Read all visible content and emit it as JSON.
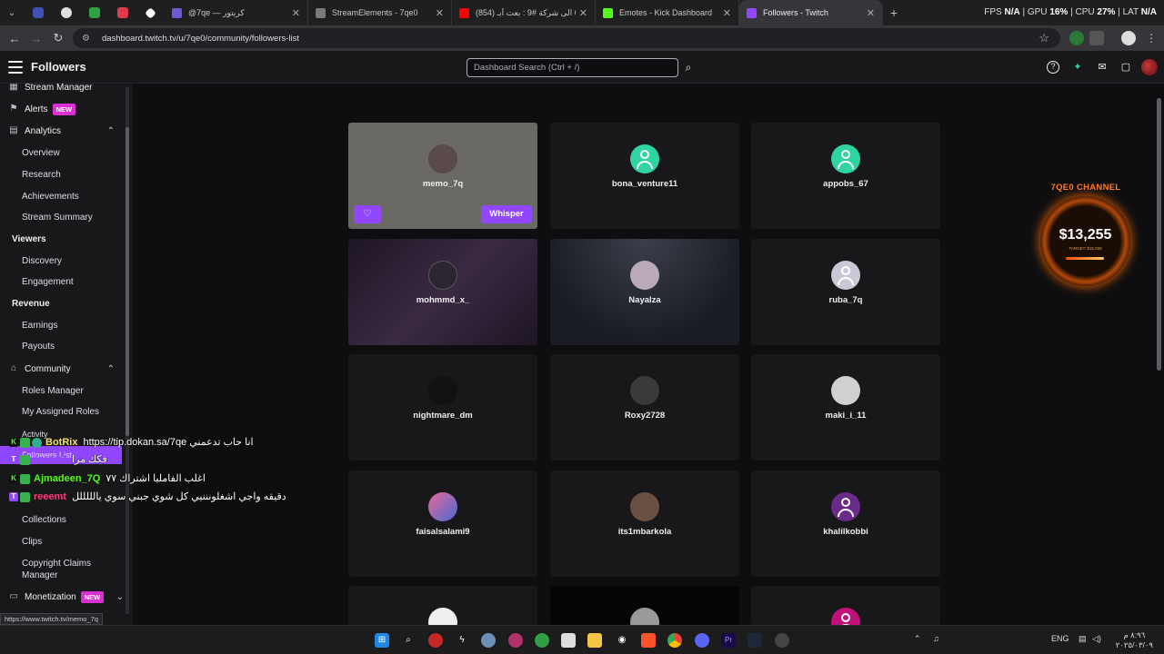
{
  "browser": {
    "tabs": [
      {
        "title": "@7qe — كريتور",
        "color": "#6b5bd6"
      },
      {
        "title": "StreamElements - 7qe0",
        "color": "#7a7a7a"
      },
      {
        "title": "(854) من 0 الى شركة #9 : بعت أبـ...",
        "color": "#ff0000"
      },
      {
        "title": "Emotes - Kick Dashboard",
        "color": "#53fc18"
      },
      {
        "title": "Followers - Twitch",
        "color": "#9147ff"
      }
    ],
    "stats": {
      "fps_label": "FPS",
      "fps_value": "N/A",
      "gpu_label": "GPU",
      "gpu_value": "16%",
      "cpu_label": "CPU",
      "cpu_value": "27%",
      "lat_label": "LAT",
      "lat_value": "N/A"
    },
    "url": "dashboard.twitch.tv/u/7qe0/community/followers-list"
  },
  "header": {
    "title": "Followers",
    "search_placeholder": "Dashboard Search (Ctrl + /)"
  },
  "sidebar": {
    "items": [
      {
        "label": "Stream Manager",
        "kind": "top"
      },
      {
        "label": "Alerts",
        "kind": "top",
        "badge": "NEW"
      },
      {
        "label": "Analytics",
        "kind": "top"
      },
      {
        "label": "Overview",
        "kind": "sub"
      },
      {
        "label": "Research",
        "kind": "sub"
      },
      {
        "label": "Achievements",
        "kind": "sub"
      },
      {
        "label": "Stream Summary",
        "kind": "sub"
      },
      {
        "label": "Viewers",
        "kind": "head"
      },
      {
        "label": "Discovery",
        "kind": "sub"
      },
      {
        "label": "Engagement",
        "kind": "sub"
      },
      {
        "label": "Revenue",
        "kind": "head"
      },
      {
        "label": "Earnings",
        "kind": "sub"
      },
      {
        "label": "Payouts",
        "kind": "sub"
      },
      {
        "label": "Community",
        "kind": "top"
      },
      {
        "label": "Roles Manager",
        "kind": "sub"
      },
      {
        "label": "My Assigned Roles",
        "kind": "sub"
      },
      {
        "label": "Activity",
        "kind": "sub"
      },
      {
        "label": "Followers List",
        "kind": "sub"
      },
      {
        "label": "Collections",
        "kind": "sub"
      },
      {
        "label": "Clips",
        "kind": "sub"
      },
      {
        "label": "Copyright Claims",
        "kind": "sub"
      },
      {
        "label": "Manager",
        "kind": "sub"
      },
      {
        "label": "Monetization",
        "kind": "top",
        "badge": "NEW"
      }
    ]
  },
  "followers": [
    {
      "name": "memo_7q",
      "avatar": "#5a4a4a"
    },
    {
      "name": "bona_venture11",
      "avatar": "default"
    },
    {
      "name": "appobs_67",
      "avatar": "default"
    },
    {
      "name": "mohmmd_x_",
      "avatar": "#2a2530"
    },
    {
      "name": "Nayalza",
      "avatar": "#b9a9b9"
    },
    {
      "name": "ruba_7q",
      "avatar": "#c9c8d6"
    },
    {
      "name": "nightmare_dm",
      "avatar": "#111111"
    },
    {
      "name": "Roxy2728",
      "avatar": "#3a3a3a"
    },
    {
      "name": "maki_i_11",
      "avatar": "#d0d0d0"
    },
    {
      "name": "faisalsalami9",
      "avatar": "#c04a7a"
    },
    {
      "name": "its1mbarkola",
      "avatar": "#6a5040"
    },
    {
      "name": "khalilkobbi",
      "avatar": "#6a2a8a"
    }
  ],
  "card_actions": {
    "whisper": "Whisper"
  },
  "channel_widget": {
    "title": "7QE0 CHANNEL",
    "amount": "$13,255",
    "target": "TARGET: $15,000"
  },
  "chat": [
    {
      "platform": "K",
      "user": "BotRix",
      "user_color": "#f7e35a",
      "message": "https://tip.dokan.sa/7qe انا حاب تدعمني"
    },
    {
      "platform": "T",
      "user": "reeemt",
      "user_color": "#9147ff",
      "message": "فكك مرا"
    },
    {
      "platform": "K",
      "user": "Ajmadeen_7Q",
      "user_color": "#53fc18",
      "message": "اغلب الفامليا اشتراك ٧٧"
    },
    {
      "platform": "T",
      "user": "reeemt",
      "user_color": "#ff3b7a",
      "message": "دقيقه واجي اشغلونننيي كل شوي جبني سوي يالللللل"
    }
  ],
  "status_url": "https://www.twitch.tv/memo_7q",
  "taskbar": {
    "lang": "ENG",
    "time": "٨:٩٦ م",
    "date": "٢٠٢٥/٠٣/٠٩"
  }
}
